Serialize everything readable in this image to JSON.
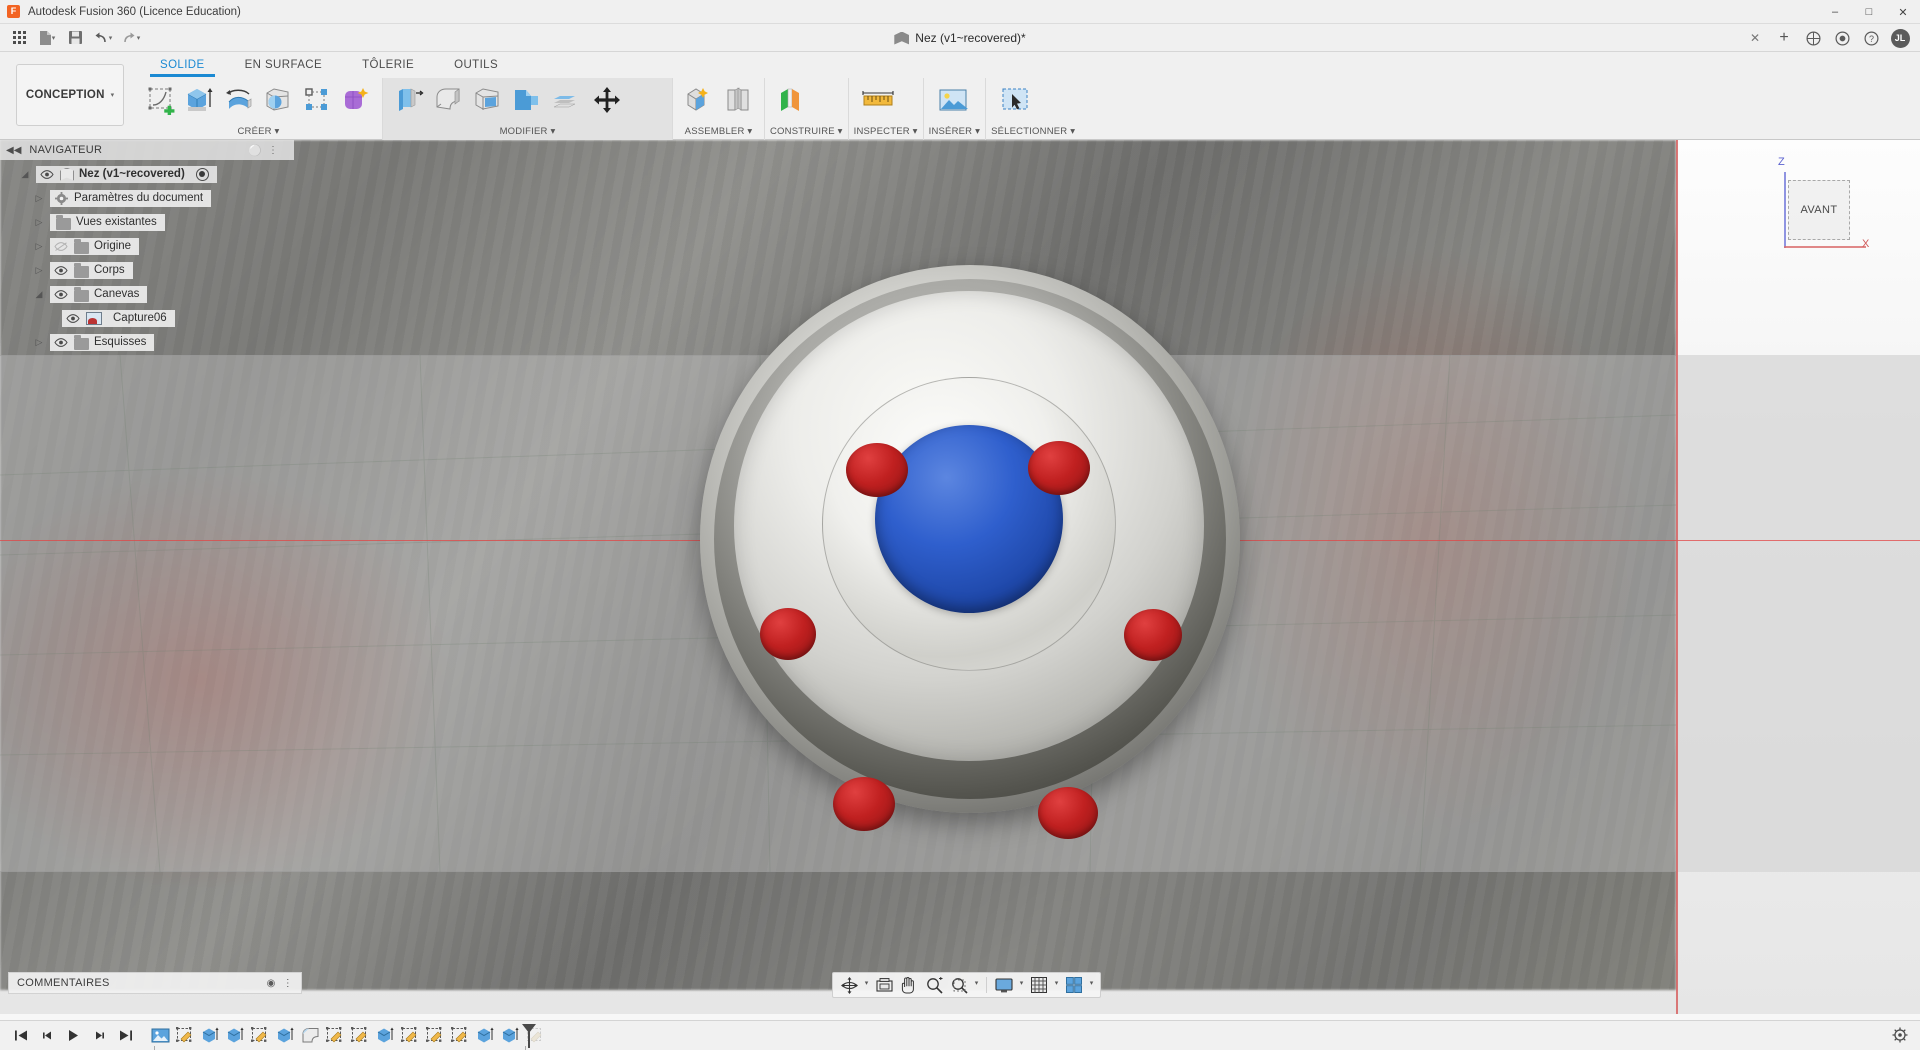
{
  "app": {
    "window_title": "Autodesk Fusion 360 (Licence Education)",
    "logo_letter": "F",
    "document_title": "Nez (v1~recovered)*"
  },
  "window_controls": {
    "minimize": "–",
    "maximize": "□",
    "close": "✕"
  },
  "quick_access": {
    "grid_icon": "grid-icon",
    "new_icon": "new-document-icon",
    "save_icon": "save-icon",
    "undo_icon": "undo-icon",
    "redo_icon": "redo-icon",
    "caret": "▾"
  },
  "doc_tabs": {
    "close_label": "✕",
    "add_label": "+",
    "extensions_icon": "extensions-icon",
    "help_icon": "help-icon",
    "notify_icon": "notification-icon",
    "account_initials": "JL"
  },
  "workspace": {
    "label": "CONCEPTION",
    "caret": "▾"
  },
  "ribbon": {
    "tabs": [
      {
        "label": "SOLIDE",
        "active": true
      },
      {
        "label": "EN SURFACE",
        "active": false
      },
      {
        "label": "TÔLERIE",
        "active": false
      },
      {
        "label": "OUTILS",
        "active": false
      }
    ],
    "groups": [
      {
        "label": "CRÉER ▾",
        "highlighted": false,
        "icons": [
          "create-sketch-icon",
          "extrude-icon",
          "revolve-icon",
          "sweep-icon",
          "pattern-icon",
          "form-icon"
        ]
      },
      {
        "label": "MODIFIER ▾",
        "highlighted": true,
        "icons": [
          "press-pull-icon",
          "fillet-icon",
          "shell-icon",
          "draft-icon",
          "scale-icon",
          "move-copy-icon"
        ]
      },
      {
        "label": "ASSEMBLER ▾",
        "highlighted": false,
        "icons": [
          "new-component-icon",
          "joint-icon"
        ]
      },
      {
        "label": "CONSTRUIRE ▾",
        "highlighted": false,
        "icons": [
          "offset-plane-icon"
        ]
      },
      {
        "label": "INSPECTER ▾",
        "highlighted": false,
        "icons": [
          "measure-icon"
        ]
      },
      {
        "label": "INSÉRER ▾",
        "highlighted": false,
        "icons": [
          "insert-canvas-icon"
        ]
      },
      {
        "label": "SÉLECTIONNER ▾",
        "highlighted": false,
        "icons": [
          "select-icon"
        ]
      }
    ]
  },
  "navigator": {
    "title": "NAVIGATEUR",
    "collapse_icon": "collapse-left-icon",
    "options_icon": "panel-options-icon",
    "tree": [
      {
        "label": "Nez (v1~recovered)",
        "indent": 0,
        "arrow": "◢",
        "visible": true,
        "icon": "component-icon",
        "selected": true,
        "has_radio": true
      },
      {
        "label": "Paramètres du document",
        "indent": 1,
        "arrow": "▷",
        "visible": null,
        "icon": "gear-icon",
        "selected": false,
        "has_radio": false
      },
      {
        "label": "Vues existantes",
        "indent": 1,
        "arrow": "▷",
        "visible": null,
        "icon": "folder-icon",
        "selected": false,
        "has_radio": false
      },
      {
        "label": "Origine",
        "indent": 1,
        "arrow": "▷",
        "visible": false,
        "icon": "folder-icon",
        "selected": false,
        "has_radio": false
      },
      {
        "label": "Corps",
        "indent": 1,
        "arrow": "▷",
        "visible": true,
        "icon": "folder-icon",
        "selected": false,
        "has_radio": false
      },
      {
        "label": "Canevas",
        "indent": 1,
        "arrow": "◢",
        "visible": true,
        "icon": "folder-icon",
        "selected": false,
        "has_radio": false
      },
      {
        "label": "Capture06",
        "indent": 2,
        "arrow": "",
        "visible": true,
        "icon": "canvas-image-icon",
        "selected": false,
        "has_radio": false
      },
      {
        "label": "Esquisses",
        "indent": 1,
        "arrow": "▷",
        "visible": true,
        "icon": "folder-icon",
        "selected": false,
        "has_radio": false
      }
    ]
  },
  "viewcube": {
    "face_label": "AVANT",
    "axis_z": "Z",
    "axis_x": "X"
  },
  "comments": {
    "label": "COMMENTAIRES",
    "add_icon": "add-comment-icon",
    "resize_icon": "resize-grip-icon"
  },
  "navigation_bar": {
    "items": [
      {
        "name": "orbit-icon",
        "caret": true
      },
      {
        "name": "fit-view-icon",
        "caret": false
      },
      {
        "name": "pan-icon",
        "caret": false
      },
      {
        "name": "zoom-icon",
        "caret": false
      },
      {
        "name": "zoom-window-icon",
        "caret": true
      },
      {
        "name": "display-settings-icon",
        "caret": true
      },
      {
        "name": "grid-snaps-icon",
        "caret": true
      },
      {
        "name": "viewports-icon",
        "caret": true
      }
    ]
  },
  "timeline": {
    "playback": [
      {
        "name": "skip-to-start-icon",
        "glyph": "⧏|"
      },
      {
        "name": "step-back-icon",
        "glyph": "◂"
      },
      {
        "name": "play-icon",
        "glyph": "▶"
      },
      {
        "name": "step-forward-icon",
        "glyph": "▸"
      },
      {
        "name": "skip-to-end-icon",
        "glyph": "|⧐"
      }
    ],
    "features": [
      {
        "name": "canvas-feature",
        "type": "canvas"
      },
      {
        "name": "sketch-feature-1",
        "type": "sketch"
      },
      {
        "name": "extrude-feature-1",
        "type": "extrude"
      },
      {
        "name": "extrude-feature-2",
        "type": "extrude"
      },
      {
        "name": "sketch-feature-2",
        "type": "sketch"
      },
      {
        "name": "extrude-feature-3",
        "type": "extrude"
      },
      {
        "name": "fillet-feature-1",
        "type": "fillet"
      },
      {
        "name": "sketch-feature-3",
        "type": "sketch"
      },
      {
        "name": "sketch-feature-4",
        "type": "sketch"
      },
      {
        "name": "extrude-feature-4",
        "type": "extrude"
      },
      {
        "name": "sketch-feature-5",
        "type": "sketch"
      },
      {
        "name": "sketch-feature-6",
        "type": "sketch"
      },
      {
        "name": "sketch-feature-7",
        "type": "sketch"
      },
      {
        "name": "extrude-feature-5",
        "type": "extrude"
      },
      {
        "name": "extrude-feature-6",
        "type": "extrude"
      },
      {
        "name": "sketch-feature-8",
        "type": "sketch-ghost"
      }
    ],
    "settings_icon": "timeline-settings-icon"
  },
  "colors": {
    "accent": "#1b8ad3",
    "brand_orange": "#f26322",
    "hub_blue": "#2f5fcd",
    "bolt_red": "#c02020",
    "axis_red": "#d95b5b",
    "axis_blue": "#6b72d8"
  },
  "model": {
    "hub_color": "#2f5fcd",
    "bolt_color": "#c02020",
    "bolt_count": 6
  }
}
